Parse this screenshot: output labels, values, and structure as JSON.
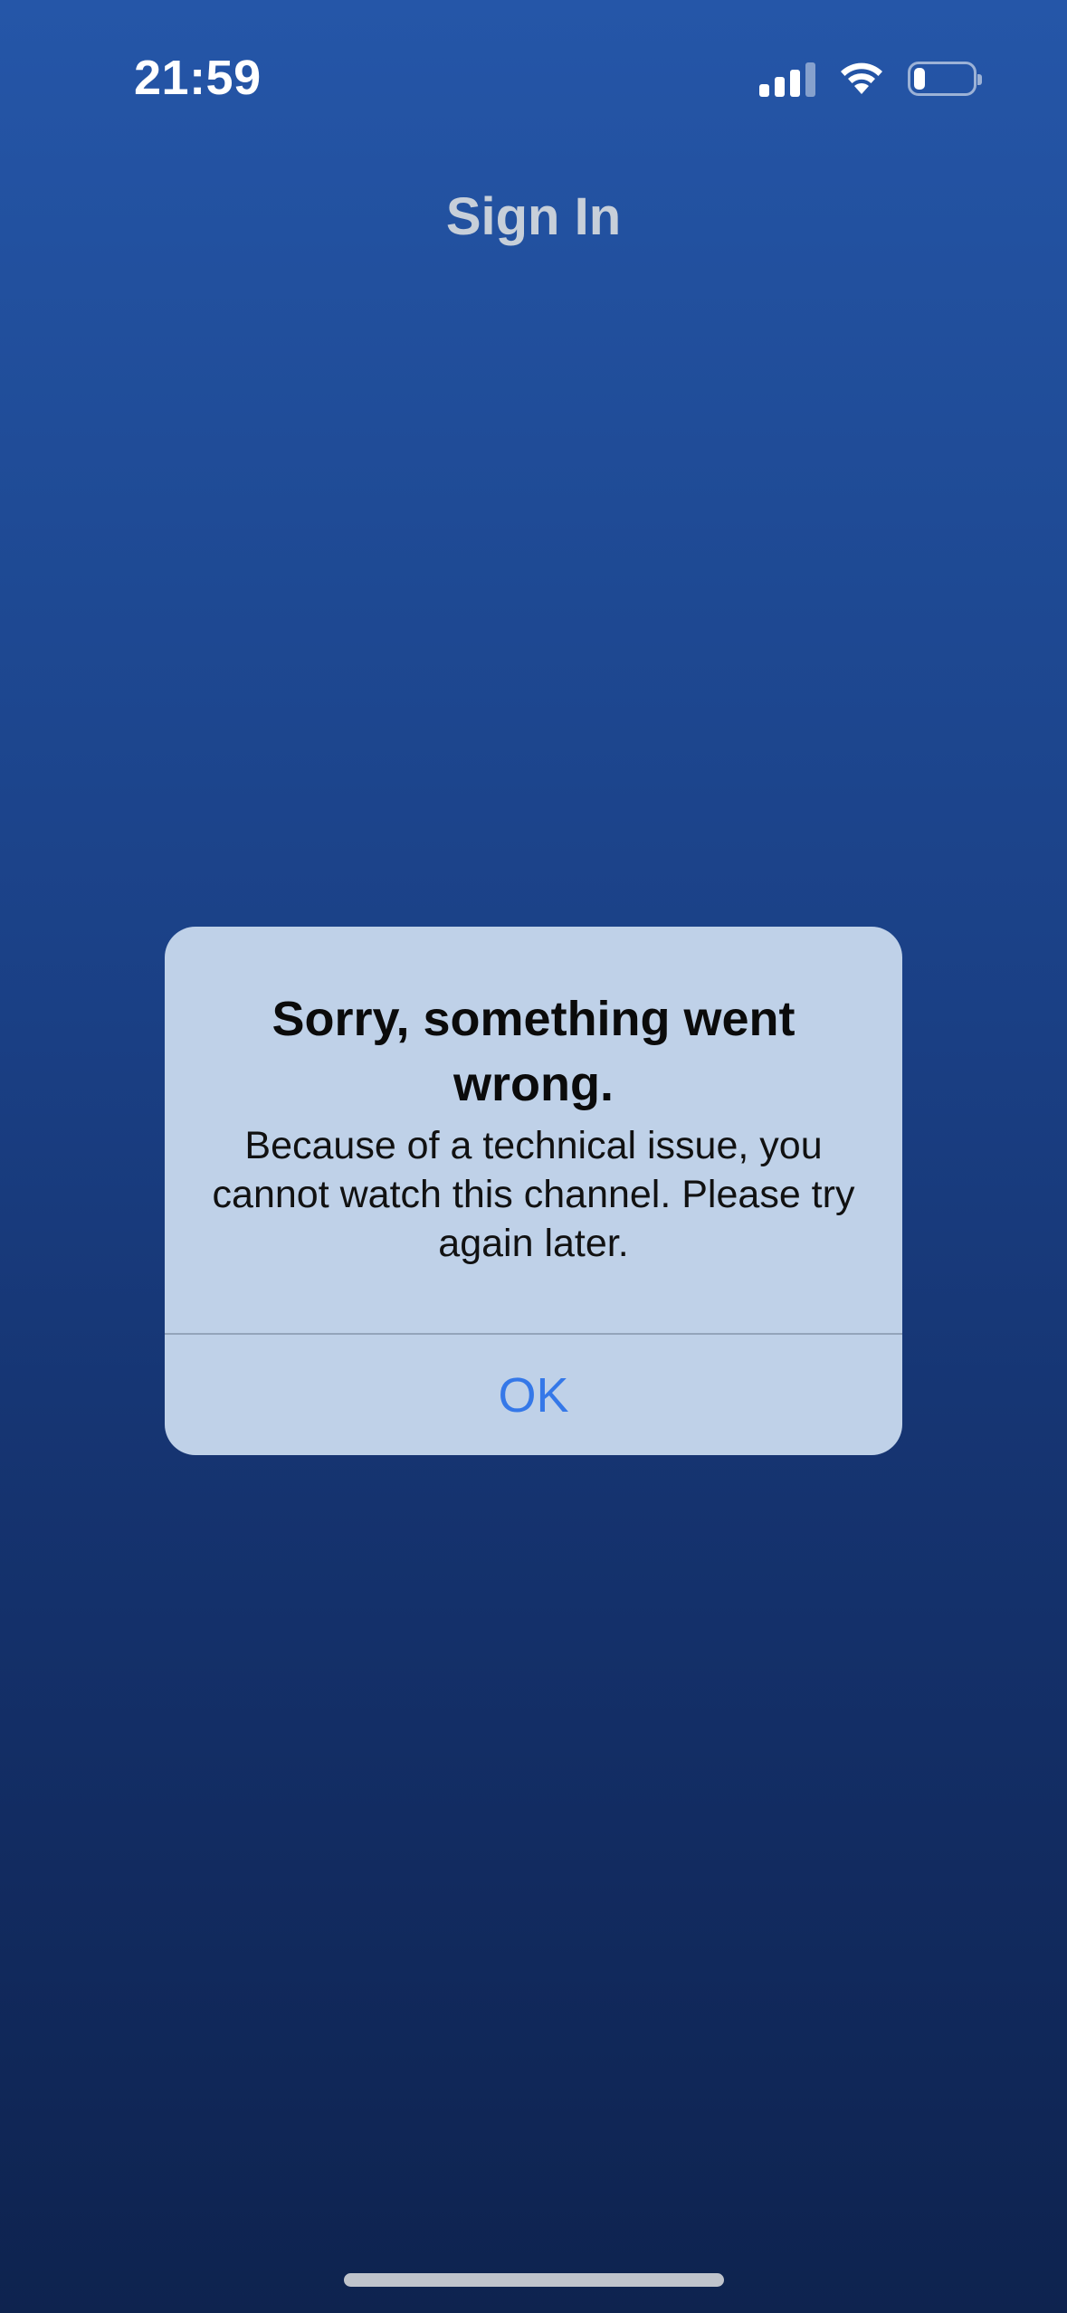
{
  "status_bar": {
    "time": "21:59",
    "signal_icon": "cellular-signal-icon",
    "wifi_icon": "wifi-icon",
    "battery_icon": "battery-icon",
    "battery_level": 0.2
  },
  "nav": {
    "title": "Sign In"
  },
  "alert": {
    "title": "Sorry, something went wrong.",
    "message": "Because of a technical issue, you cannot watch this channel. Please try again later.",
    "ok_label": "OK"
  },
  "colors": {
    "background_top": "#2556a8",
    "background_bottom": "#0e234f",
    "alert_background": "#bfd1e8",
    "alert_button": "#3578e8"
  }
}
